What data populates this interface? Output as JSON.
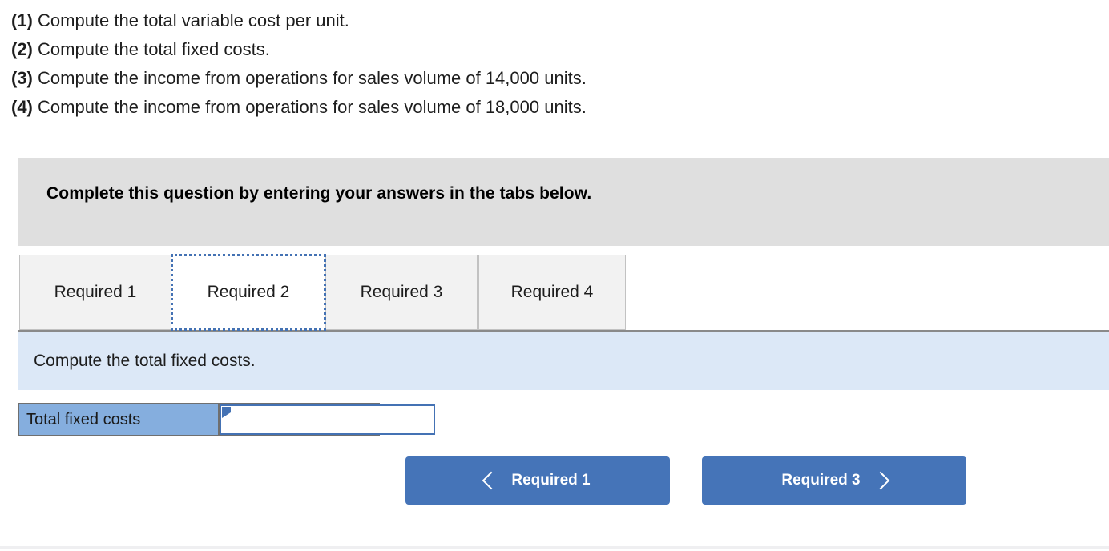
{
  "questions": [
    {
      "num": "(1)",
      "text": " Compute the total variable cost per unit."
    },
    {
      "num": "(2)",
      "text": " Compute the total fixed costs."
    },
    {
      "num": "(3)",
      "text": " Compute the income from operations for sales volume of 14,000 units."
    },
    {
      "num": "(4)",
      "text": " Compute the income from operations for sales volume of 18,000 units."
    }
  ],
  "banner": {
    "text": "Complete this question by entering your answers in the tabs below."
  },
  "tabs": [
    {
      "label": "Required 1",
      "active": false
    },
    {
      "label": "Required 2",
      "active": true
    },
    {
      "label": "Required 3",
      "active": false
    },
    {
      "label": "Required 4",
      "active": false
    }
  ],
  "sub_instruction": {
    "text": "Compute the total fixed costs."
  },
  "answer_row": {
    "label": "Total fixed costs",
    "value": "",
    "placeholder": ""
  },
  "nav": {
    "prev_label": "Required 1",
    "next_label": "Required 3",
    "prev_icon": "chevron-left-icon",
    "next_icon": "chevron-right-icon"
  },
  "colors": {
    "banner_gray": "#dfdfdf",
    "strip_blue": "#dce8f7",
    "cell_blue": "#85aede",
    "button_blue": "#4574b8",
    "focus_blue": "#4472b4",
    "tab_inactive": "#f2f2f2"
  }
}
